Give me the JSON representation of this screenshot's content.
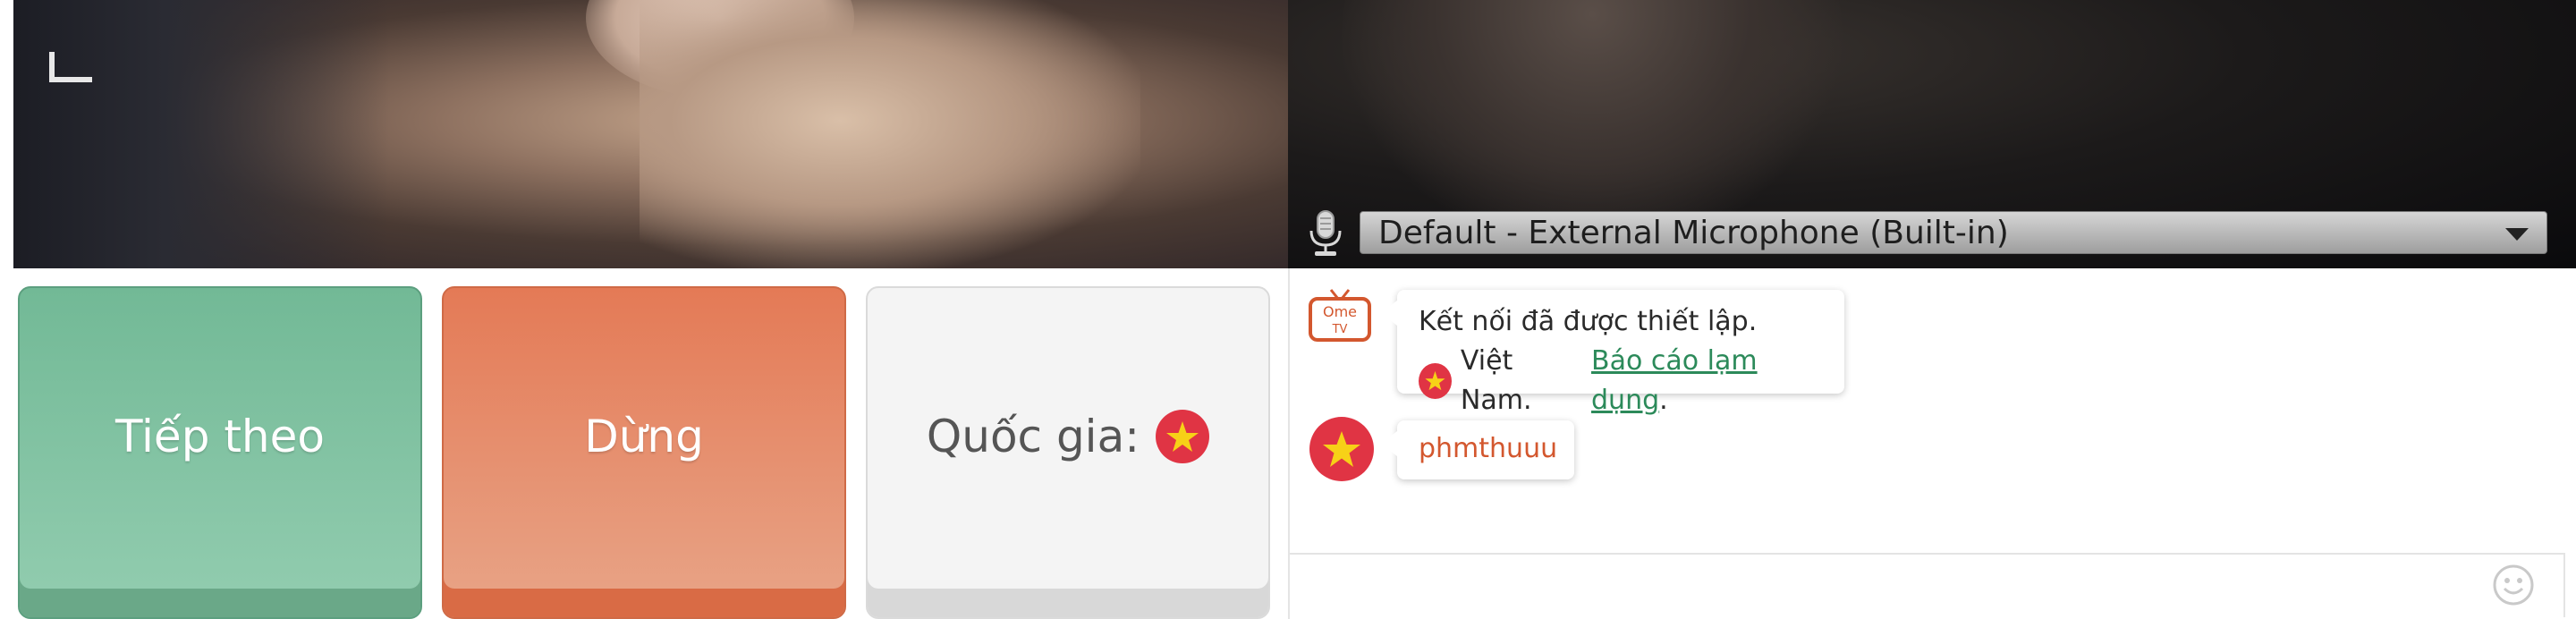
{
  "video": {
    "microphone_select": {
      "value": "Default - External Microphone (Built-in)"
    }
  },
  "controls": {
    "next_label": "Tiếp theo",
    "stop_label": "Dừng",
    "country_label": "Quốc gia:"
  },
  "chat": {
    "system_message": {
      "line1": "Kết nối đã được thiết lập.",
      "country": "Việt Nam.",
      "report_link": "Báo cáo lạm dụng",
      "trailing": "."
    },
    "user_message": {
      "text": "phmthuuu"
    },
    "logo_text": {
      "top": "Ome",
      "bottom": "TV"
    }
  },
  "colors": {
    "next_green": "#72b996",
    "stop_orange": "#e47a56",
    "flag_red": "#e03444",
    "flag_star": "#f7d117",
    "link_green": "#2c8a5a",
    "username_orange": "#d3572e"
  },
  "icons": [
    "microphone-icon",
    "dropdown-caret-icon",
    "vietnam-flag-icon",
    "ometv-logo-icon",
    "smiley-icon"
  ]
}
